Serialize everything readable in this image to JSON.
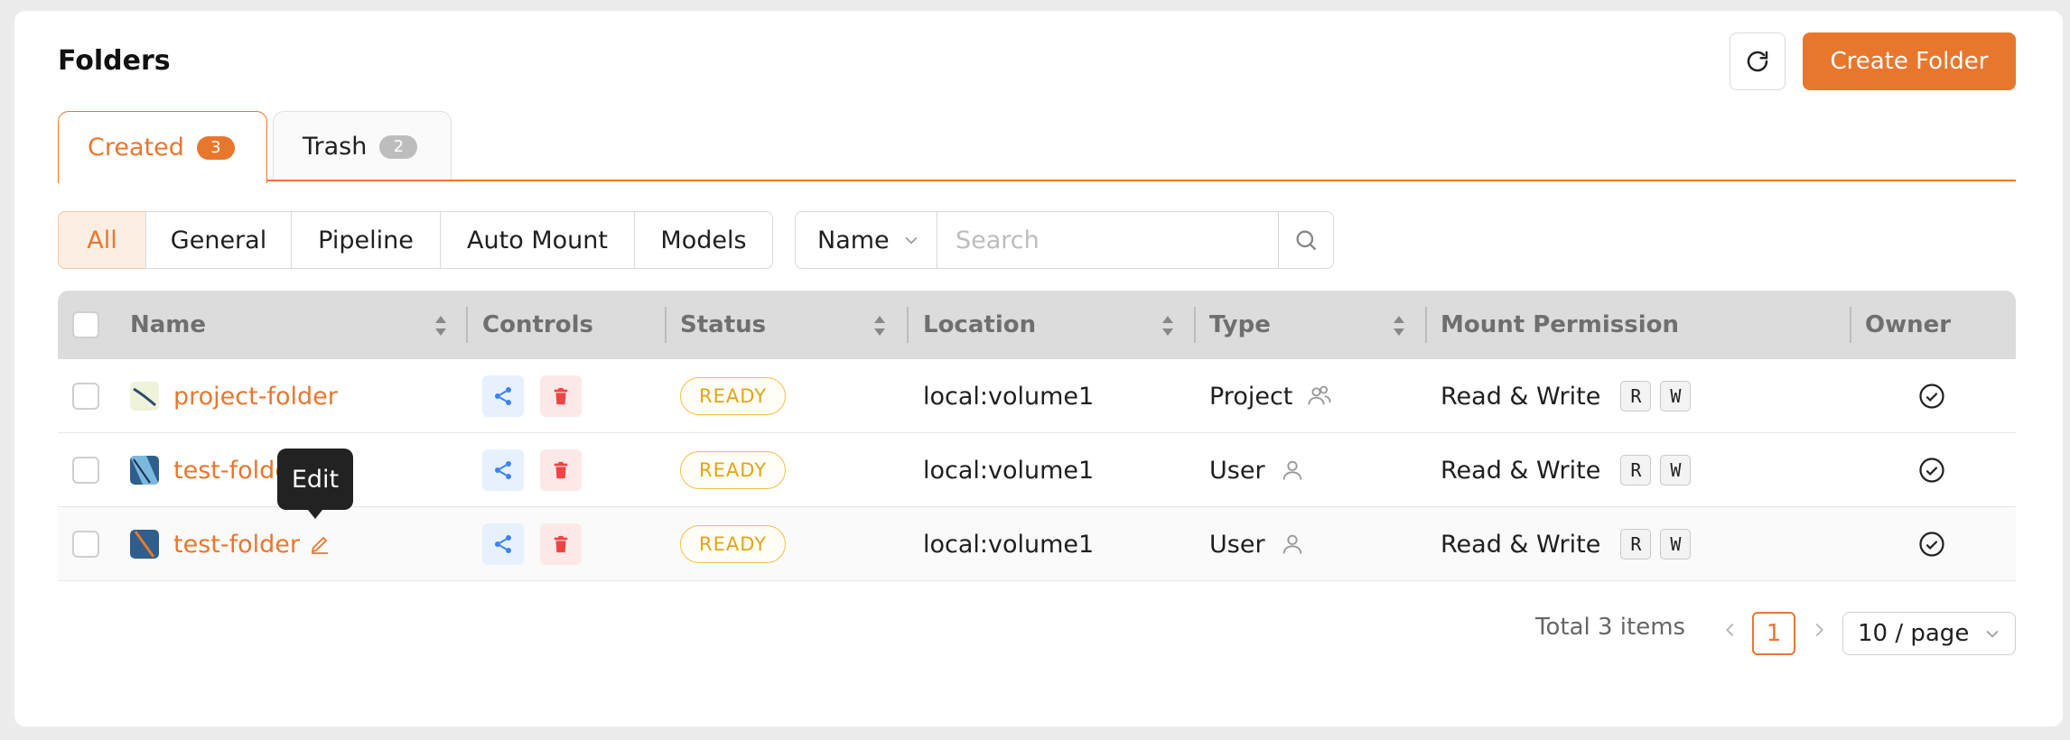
{
  "header": {
    "title": "Folders",
    "create_label": "Create Folder"
  },
  "tabs": [
    {
      "label": "Created",
      "count": "3"
    },
    {
      "label": "Trash",
      "count": "2"
    }
  ],
  "filters": [
    "All",
    "General",
    "Pipeline",
    "Auto Mount",
    "Models"
  ],
  "search": {
    "field": "Name",
    "placeholder": "Search"
  },
  "table": {
    "columns": [
      "Name",
      "Controls",
      "Status",
      "Location",
      "Type",
      "Mount Permission",
      "Owner"
    ],
    "rows": [
      {
        "name": "project-folder",
        "status": "READY",
        "location": "local:volume1",
        "type": "Project",
        "permission": "Read & Write",
        "keys": [
          "R",
          "W"
        ]
      },
      {
        "name": "test-folder",
        "status": "READY",
        "location": "local:volume1",
        "type": "User",
        "permission": "Read & Write",
        "keys": [
          "R",
          "W"
        ]
      },
      {
        "name": "test-folder",
        "status": "READY",
        "location": "local:volume1",
        "type": "User",
        "permission": "Read & Write",
        "keys": [
          "R",
          "W"
        ]
      }
    ]
  },
  "tooltip": "Edit",
  "pagination": {
    "total": "Total 3 items",
    "current": "1",
    "page_size": "10 / page"
  },
  "colors": {
    "accent": "#e8772e",
    "ready": "#e0a614",
    "share": "#3b82f6",
    "delete": "#ef4444"
  },
  "icons": [
    "refresh-icon",
    "search-icon",
    "chevron-down-icon",
    "share-icon",
    "trash-icon",
    "edit-icon",
    "project-icon",
    "user-icon",
    "check-circle-icon",
    "sort-icon"
  ]
}
